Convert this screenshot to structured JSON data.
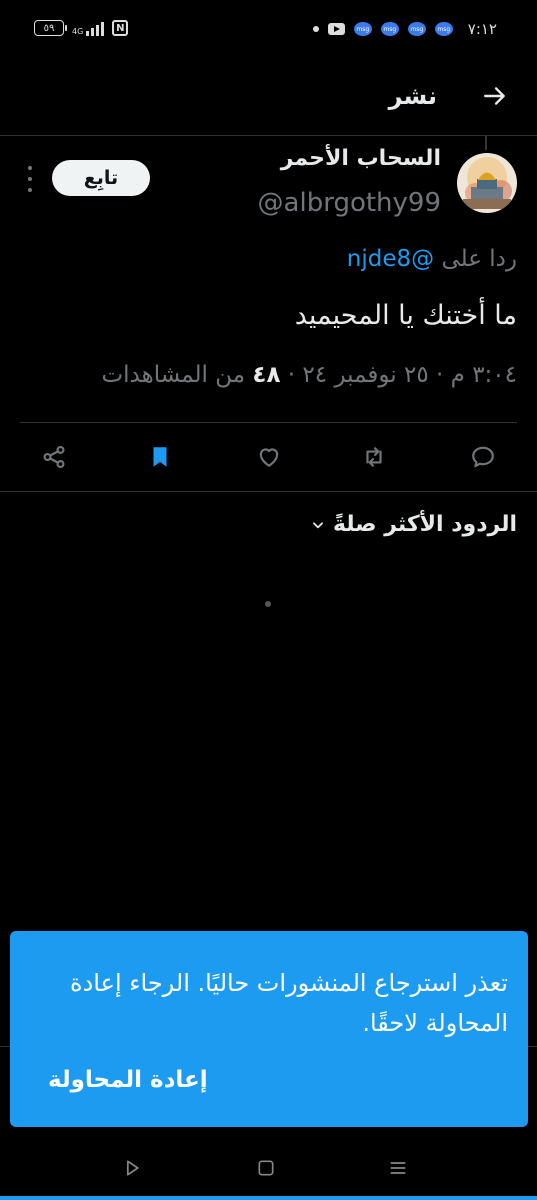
{
  "status_bar": {
    "time": "٧:١٢",
    "battery": "٥٩",
    "signal_label": "4G",
    "nfc": "N",
    "notification_icons": [
      "dot-icon",
      "youtube-icon",
      "messenger-icon",
      "messenger-icon",
      "messenger-icon",
      "messenger-icon"
    ],
    "messenger_label": "msg"
  },
  "header": {
    "title": "نشر",
    "back_icon": "arrow-right-icon"
  },
  "tweet": {
    "author_name": "السحاب الأحمر",
    "author_handle": "@albrgothy99",
    "follow_label": "تابِع",
    "reply_prefix": "ردا على",
    "reply_mention": "@njde8",
    "text": "ما أختنك يا المحيميد",
    "time": "٣:٠٤ م",
    "date": "٢٥ نوفمبر ٢٤",
    "views_count": "٤٨",
    "views_label": "من المشاهدات",
    "separator": "·"
  },
  "actions": [
    "reply-icon",
    "retweet-icon",
    "like-icon",
    "bookmark-icon",
    "share-icon"
  ],
  "sort": {
    "label": "الردود الأكثر صلةً"
  },
  "toast": {
    "message": "تعذر استرجاع المنشورات حاليًا. الرجاء إعادة المحاولة لاحقًا.",
    "retry_label": "إعادة المحاولة"
  },
  "colors": {
    "accent": "#1d9bf0",
    "background": "#000000",
    "text": "#e7e9ea",
    "muted": "#71767b"
  }
}
